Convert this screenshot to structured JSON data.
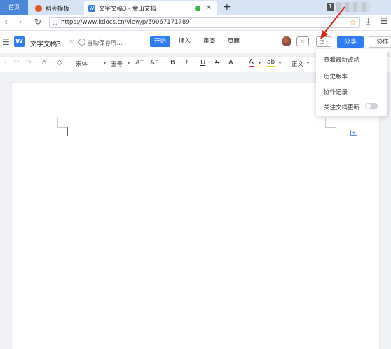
{
  "browser": {
    "tabs": [
      {
        "label": "首页"
      },
      {
        "label": "稻壳模板"
      },
      {
        "label": "文字文稿3 - 金山文档"
      }
    ],
    "new_tab": "+",
    "tab_count": "1",
    "close_glyph": "✕",
    "url": "https://www.kdocs.cn/view/p/59067171789",
    "nav": {
      "back": "‹",
      "forward": "›",
      "reload": "↻"
    },
    "icons": {
      "star": "star-icon",
      "download": "download-icon",
      "menu": "menu-icon",
      "shield": "shield-icon"
    }
  },
  "app": {
    "logo": "W",
    "doc_title": "文字文稿3",
    "save_status": "自动保存所...",
    "menu_tabs": [
      "开始",
      "插入",
      "审阅",
      "页面"
    ],
    "active_tab": "开始",
    "share_label": "分享",
    "collab_label": "协作",
    "brand_color": "#2e7cf6"
  },
  "toolbar": {
    "font_name": "宋体",
    "font_size": "五号",
    "grow": "A⁺",
    "shrink": "A⁻",
    "bold": "B",
    "italic": "I",
    "underline": "U",
    "strike": "S",
    "font_effect": "A",
    "font_color": "A",
    "highlight": "ab",
    "style": "正文"
  },
  "history_menu": {
    "items": [
      "查看最新改动",
      "历史版本",
      "协作记录",
      "关注文档更新"
    ],
    "follow_toggle": false
  }
}
